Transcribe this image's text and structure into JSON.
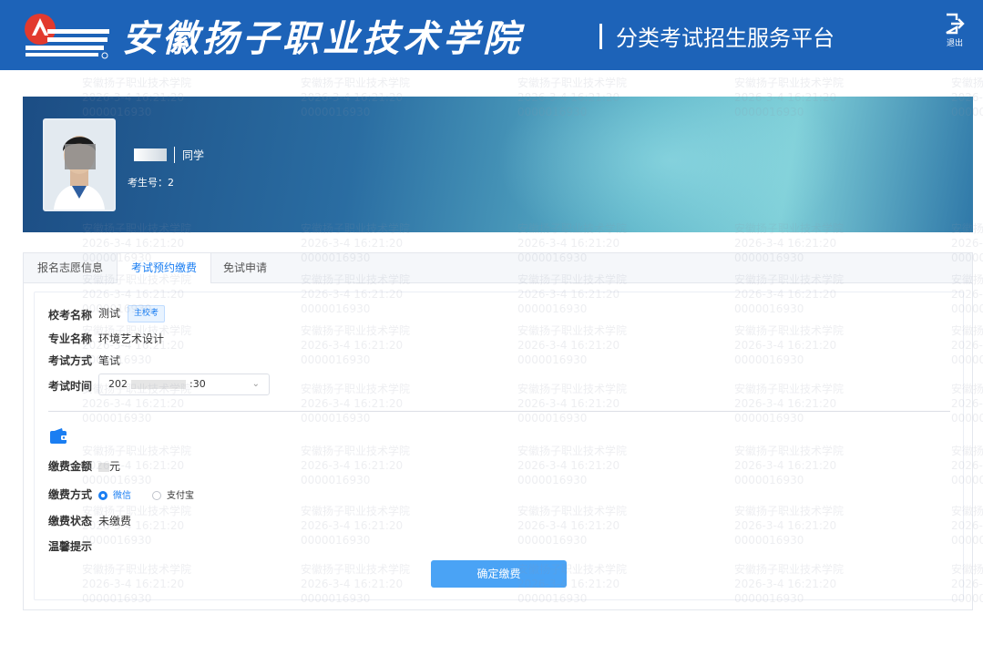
{
  "header": {
    "school_name": "安徽扬子职业技术学院",
    "platform_name": "分类考试招生服务平台",
    "logout_label": "退出",
    "icons": {
      "logo": "school-logo",
      "logout": "logout-icon"
    }
  },
  "watermark": {
    "line1": "安徽扬子职业技术学院",
    "line2": "2026-3-4 16:21:20",
    "line3": "0000016930"
  },
  "profile": {
    "name_suffix": "同学",
    "exam_no_label": "考生号：",
    "exam_no_value": "2"
  },
  "tabs": [
    {
      "label": "报名志愿信息",
      "active": false
    },
    {
      "label": "考试预约缴费",
      "active": true
    },
    {
      "label": "免试申请",
      "active": false
    }
  ],
  "info": {
    "school_label": "校考名称",
    "school_value": "测试",
    "school_tag": "主校考",
    "major_label": "专业名称",
    "major_value": "环境艺术设计",
    "method_label": "考试方式",
    "method_value": "笔试",
    "time_label": "考试时间",
    "time_value_start": "202",
    "time_value_end": ":30"
  },
  "payment": {
    "icon": "wallet-icon",
    "amount_label": "缴费金额",
    "amount_value": "元",
    "method_label": "缴费方式",
    "options": [
      {
        "label": "微信",
        "checked": true
      },
      {
        "label": "支付宝",
        "checked": false
      }
    ],
    "status_label": "缴费状态",
    "status_value": "未缴费",
    "tips_label": "温馨提示",
    "confirm_button": "确定缴费"
  },
  "colors": {
    "header_bg": "#1d63b8",
    "accent": "#1a7ef2",
    "button_bg": "#4aa3f5"
  }
}
